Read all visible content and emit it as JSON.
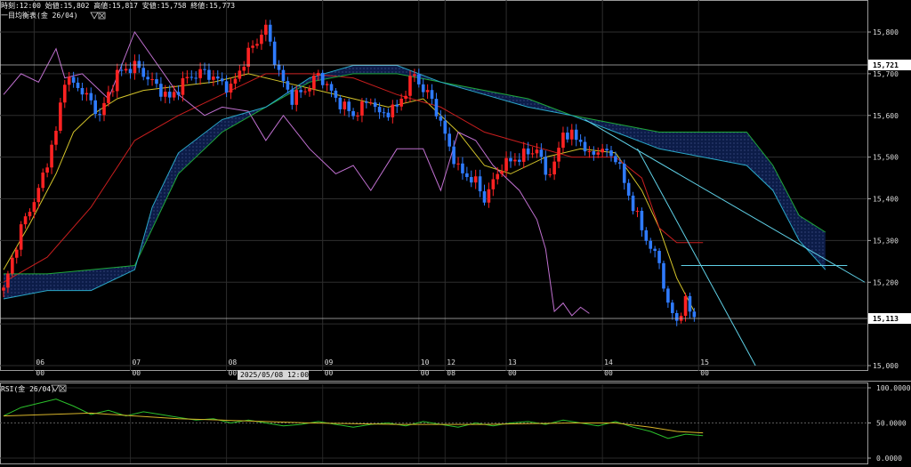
{
  "header": {
    "ohlc": "時刻:12:00 始値:15,802 高値:15,817 安値:15,758 終値:15,773",
    "indicator": "一目均衡表(金 26/04)"
  },
  "rsi_panel": {
    "title": "RSI(金 26/04)"
  },
  "crosshair_time": "2025/05/08 12:00",
  "colors": {
    "background": "#000000",
    "up": "#ff2222",
    "down": "#2f7bff",
    "tenkan": "#d4c42a",
    "kijun": "#c81e1e",
    "chikou": "#c070d0",
    "kumo_top": "#1fa83a",
    "kumo_bottom": "#2aa8c8",
    "kumo_fill": "#0c1c48",
    "trendline": "#5fd0e6",
    "rsi_main": "#2bc02b",
    "rsi_signal": "#d7b42a"
  },
  "chart_data": [
    {
      "type": "candlestick",
      "title": "",
      "y_axis": {
        "ticks": [
          "15,800",
          "15,700",
          "15,600",
          "15,500",
          "15,400",
          "15,300",
          "15,200",
          "15,000"
        ],
        "ylim": [
          14980,
          15850
        ],
        "side": "right"
      },
      "highlighted_prices": [
        {
          "label": "15,721",
          "value": 15721
        },
        {
          "label": "15,113",
          "value": 15113
        }
      ],
      "x_axis": [
        {
          "day": "06",
          "time": "00"
        },
        {
          "day": "07",
          "time": "00"
        },
        {
          "day": "08",
          "time": "00"
        },
        {
          "day": "09",
          "time": "00"
        },
        {
          "day": "10",
          "time": "00"
        },
        {
          "day": "12",
          "time": "08"
        },
        {
          "day": "13",
          "time": "00"
        },
        {
          "day": "14",
          "time": "00"
        },
        {
          "day": "15",
          "time": "00"
        }
      ],
      "close_path": [
        [
          0,
          15180
        ],
        [
          4,
          15330
        ],
        [
          8,
          15420
        ],
        [
          12,
          15560
        ],
        [
          14,
          15690
        ],
        [
          18,
          15660
        ],
        [
          22,
          15600
        ],
        [
          26,
          15700
        ],
        [
          30,
          15720
        ],
        [
          34,
          15680
        ],
        [
          38,
          15640
        ],
        [
          42,
          15690
        ],
        [
          46,
          15705
        ],
        [
          48,
          15690
        ],
        [
          52,
          15665
        ],
        [
          56,
          15750
        ],
        [
          60,
          15810
        ],
        [
          63,
          15700
        ],
        [
          66,
          15640
        ],
        [
          70,
          15670
        ],
        [
          72,
          15700
        ],
        [
          76,
          15640
        ],
        [
          80,
          15600
        ],
        [
          84,
          15640
        ],
        [
          86,
          15600
        ],
        [
          90,
          15620
        ],
        [
          94,
          15700
        ],
        [
          96,
          15660
        ],
        [
          98,
          15640
        ],
        [
          100,
          15580
        ],
        [
          104,
          15470
        ],
        [
          108,
          15440
        ],
        [
          110,
          15400
        ],
        [
          114,
          15480
        ],
        [
          118,
          15500
        ],
        [
          122,
          15520
        ],
        [
          124,
          15460
        ],
        [
          126,
          15480
        ],
        [
          128,
          15560
        ],
        [
          132,
          15540
        ],
        [
          134,
          15500
        ],
        [
          136,
          15520
        ],
        [
          140,
          15500
        ],
        [
          144,
          15380
        ],
        [
          148,
          15280
        ],
        [
          150,
          15250
        ],
        [
          152,
          15140
        ],
        [
          154,
          15110
        ],
        [
          156,
          15150
        ],
        [
          158,
          15120
        ]
      ],
      "series": [
        {
          "name": "",
          "role": "tenkan",
          "color": "#d4c42a",
          "points": [
            [
              0,
              15230
            ],
            [
              6,
              15340
            ],
            [
              12,
              15460
            ],
            [
              16,
              15560
            ],
            [
              20,
              15600
            ],
            [
              26,
              15640
            ],
            [
              32,
              15660
            ],
            [
              40,
              15670
            ],
            [
              48,
              15680
            ],
            [
              56,
              15700
            ],
            [
              64,
              15680
            ],
            [
              72,
              15660
            ],
            [
              80,
              15640
            ],
            [
              88,
              15620
            ],
            [
              96,
              15640
            ],
            [
              104,
              15560
            ],
            [
              110,
              15480
            ],
            [
              116,
              15460
            ],
            [
              124,
              15500
            ],
            [
              132,
              15520
            ],
            [
              140,
              15510
            ],
            [
              146,
              15420
            ],
            [
              150,
              15330
            ],
            [
              154,
              15210
            ],
            [
              158,
              15130
            ]
          ]
        },
        {
          "name": "",
          "role": "kijun",
          "color": "#c81e1e",
          "points": [
            [
              0,
              15200
            ],
            [
              10,
              15260
            ],
            [
              20,
              15380
            ],
            [
              30,
              15540
            ],
            [
              40,
              15600
            ],
            [
              50,
              15650
            ],
            [
              60,
              15700
            ],
            [
              70,
              15700
            ],
            [
              80,
              15690
            ],
            [
              90,
              15650
            ],
            [
              100,
              15620
            ],
            [
              110,
              15560
            ],
            [
              120,
              15530
            ],
            [
              130,
              15500
            ],
            [
              140,
              15500
            ],
            [
              146,
              15450
            ],
            [
              150,
              15330
            ],
            [
              154,
              15295
            ],
            [
              160,
              15295
            ]
          ]
        },
        {
          "name": "",
          "role": "chikou",
          "color": "#c070d0",
          "points": [
            [
              0,
              15650
            ],
            [
              4,
              15700
            ],
            [
              8,
              15680
            ],
            [
              12,
              15760
            ],
            [
              14,
              15690
            ],
            [
              18,
              15700
            ],
            [
              24,
              15640
            ],
            [
              30,
              15800
            ],
            [
              34,
              15740
            ],
            [
              40,
              15650
            ],
            [
              46,
              15600
            ],
            [
              50,
              15620
            ],
            [
              56,
              15610
            ],
            [
              60,
              15540
            ],
            [
              64,
              15600
            ],
            [
              70,
              15520
            ],
            [
              76,
              15460
            ],
            [
              80,
              15480
            ],
            [
              84,
              15420
            ],
            [
              90,
              15520
            ],
            [
              96,
              15520
            ],
            [
              100,
              15420
            ],
            [
              104,
              15560
            ],
            [
              108,
              15540
            ],
            [
              112,
              15480
            ],
            [
              118,
              15420
            ],
            [
              122,
              15350
            ],
            [
              124,
              15280
            ],
            [
              126,
              15130
            ],
            [
              128,
              15150
            ],
            [
              130,
              15120
            ],
            [
              132,
              15140
            ],
            [
              134,
              15125
            ]
          ]
        },
        {
          "name": "",
          "role": "senkou_a",
          "color": "#1fa83a",
          "points": [
            [
              0,
              15220
            ],
            [
              10,
              15220
            ],
            [
              20,
              15230
            ],
            [
              30,
              15240
            ],
            [
              40,
              15460
            ],
            [
              50,
              15560
            ],
            [
              60,
              15620
            ],
            [
              70,
              15680
            ],
            [
              80,
              15700
            ],
            [
              90,
              15700
            ],
            [
              100,
              15680
            ],
            [
              110,
              15660
            ],
            [
              120,
              15640
            ],
            [
              130,
              15600
            ],
            [
              140,
              15580
            ],
            [
              150,
              15560
            ],
            [
              160,
              15560
            ],
            [
              170,
              15560
            ],
            [
              176,
              15480
            ],
            [
              182,
              15360
            ],
            [
              188,
              15320
            ]
          ]
        },
        {
          "name": "",
          "role": "senkou_b",
          "color": "#2aa8c8",
          "points": [
            [
              0,
              15160
            ],
            [
              10,
              15180
            ],
            [
              20,
              15180
            ],
            [
              30,
              15230
            ],
            [
              34,
              15380
            ],
            [
              40,
              15510
            ],
            [
              50,
              15590
            ],
            [
              60,
              15620
            ],
            [
              70,
              15690
            ],
            [
              80,
              15720
            ],
            [
              90,
              15720
            ],
            [
              100,
              15680
            ],
            [
              110,
              15650
            ],
            [
              120,
              15620
            ],
            [
              130,
              15600
            ],
            [
              140,
              15560
            ],
            [
              150,
              15520
            ],
            [
              160,
              15500
            ],
            [
              170,
              15480
            ],
            [
              176,
              15420
            ],
            [
              182,
              15300
            ],
            [
              188,
              15230
            ]
          ]
        }
      ],
      "trendlines": [
        {
          "points": [
            [
              133,
              15590
            ],
            [
              197,
              15200
            ]
          ]
        },
        {
          "points": [
            [
              145,
              15520
            ],
            [
              172,
              15000
            ]
          ]
        },
        {
          "points": [
            [
              155,
              15240
            ],
            [
              193,
              15240
            ]
          ]
        }
      ]
    },
    {
      "type": "line",
      "title": "RSI(金 26/04)",
      "y_axis": {
        "ticks": [
          "100.0000",
          "50.0000",
          "0.0000"
        ],
        "ylim": [
          0,
          100
        ],
        "side": "right"
      },
      "series": [
        {
          "name": "",
          "role": "rsi",
          "color": "#2bc02b",
          "points": [
            [
              0,
              60
            ],
            [
              4,
              72
            ],
            [
              8,
              78
            ],
            [
              12,
              84
            ],
            [
              16,
              74
            ],
            [
              20,
              62
            ],
            [
              24,
              68
            ],
            [
              28,
              60
            ],
            [
              32,
              66
            ],
            [
              36,
              62
            ],
            [
              40,
              58
            ],
            [
              44,
              54
            ],
            [
              48,
              56
            ],
            [
              52,
              50
            ],
            [
              56,
              54
            ],
            [
              60,
              50
            ],
            [
              64,
              46
            ],
            [
              68,
              48
            ],
            [
              72,
              52
            ],
            [
              76,
              48
            ],
            [
              80,
              44
            ],
            [
              84,
              48
            ],
            [
              88,
              50
            ],
            [
              92,
              46
            ],
            [
              96,
              52
            ],
            [
              100,
              48
            ],
            [
              104,
              44
            ],
            [
              108,
              50
            ],
            [
              112,
              46
            ],
            [
              116,
              50
            ],
            [
              120,
              52
            ],
            [
              124,
              48
            ],
            [
              128,
              54
            ],
            [
              132,
              50
            ],
            [
              136,
              46
            ],
            [
              140,
              52
            ],
            [
              144,
              44
            ],
            [
              148,
              38
            ],
            [
              152,
              28
            ],
            [
              156,
              34
            ],
            [
              160,
              32
            ]
          ]
        },
        {
          "name": "",
          "role": "rsi_signal",
          "color": "#d7b42a",
          "points": [
            [
              0,
              60
            ],
            [
              10,
              62
            ],
            [
              20,
              64
            ],
            [
              30,
              60
            ],
            [
              40,
              56
            ],
            [
              50,
              54
            ],
            [
              60,
              52
            ],
            [
              70,
              50
            ],
            [
              80,
              49
            ],
            [
              90,
              48
            ],
            [
              100,
              48
            ],
            [
              110,
              48
            ],
            [
              120,
              49
            ],
            [
              130,
              50
            ],
            [
              140,
              50
            ],
            [
              148,
              44
            ],
            [
              154,
              38
            ],
            [
              160,
              36
            ]
          ]
        }
      ]
    }
  ]
}
